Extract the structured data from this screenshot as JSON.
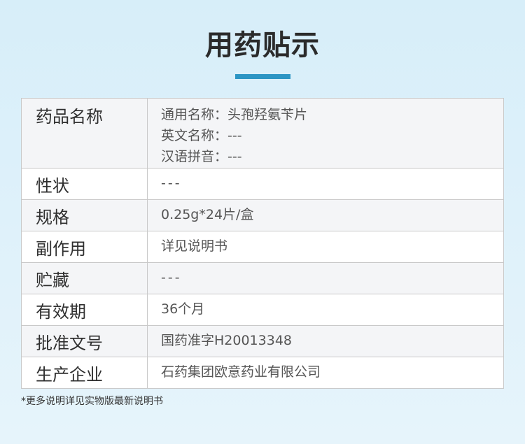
{
  "title": "用药贴示",
  "rows": [
    {
      "label": "药品名称",
      "lines": [
        "通用名称：头孢羟氨苄片",
        "英文名称：---",
        "汉语拼音：---"
      ]
    },
    {
      "label": "性状",
      "value": "---"
    },
    {
      "label": "规格",
      "value": "0.25g*24片/盒"
    },
    {
      "label": "副作用",
      "value": "详见说明书"
    },
    {
      "label": "贮藏",
      "value": "---"
    },
    {
      "label": "有效期",
      "value": "36个月"
    },
    {
      "label": "批准文号",
      "value": "国药准字H20013348"
    },
    {
      "label": "生产企业",
      "value": "石药集团欧意药业有限公司"
    }
  ],
  "footnote": "*更多说明详见实物版最新说明书",
  "colors": {
    "accent": "#2c95c4",
    "background": "#d7eef9",
    "row_alt": "#f4f5f7",
    "border": "#c9c9c9"
  }
}
